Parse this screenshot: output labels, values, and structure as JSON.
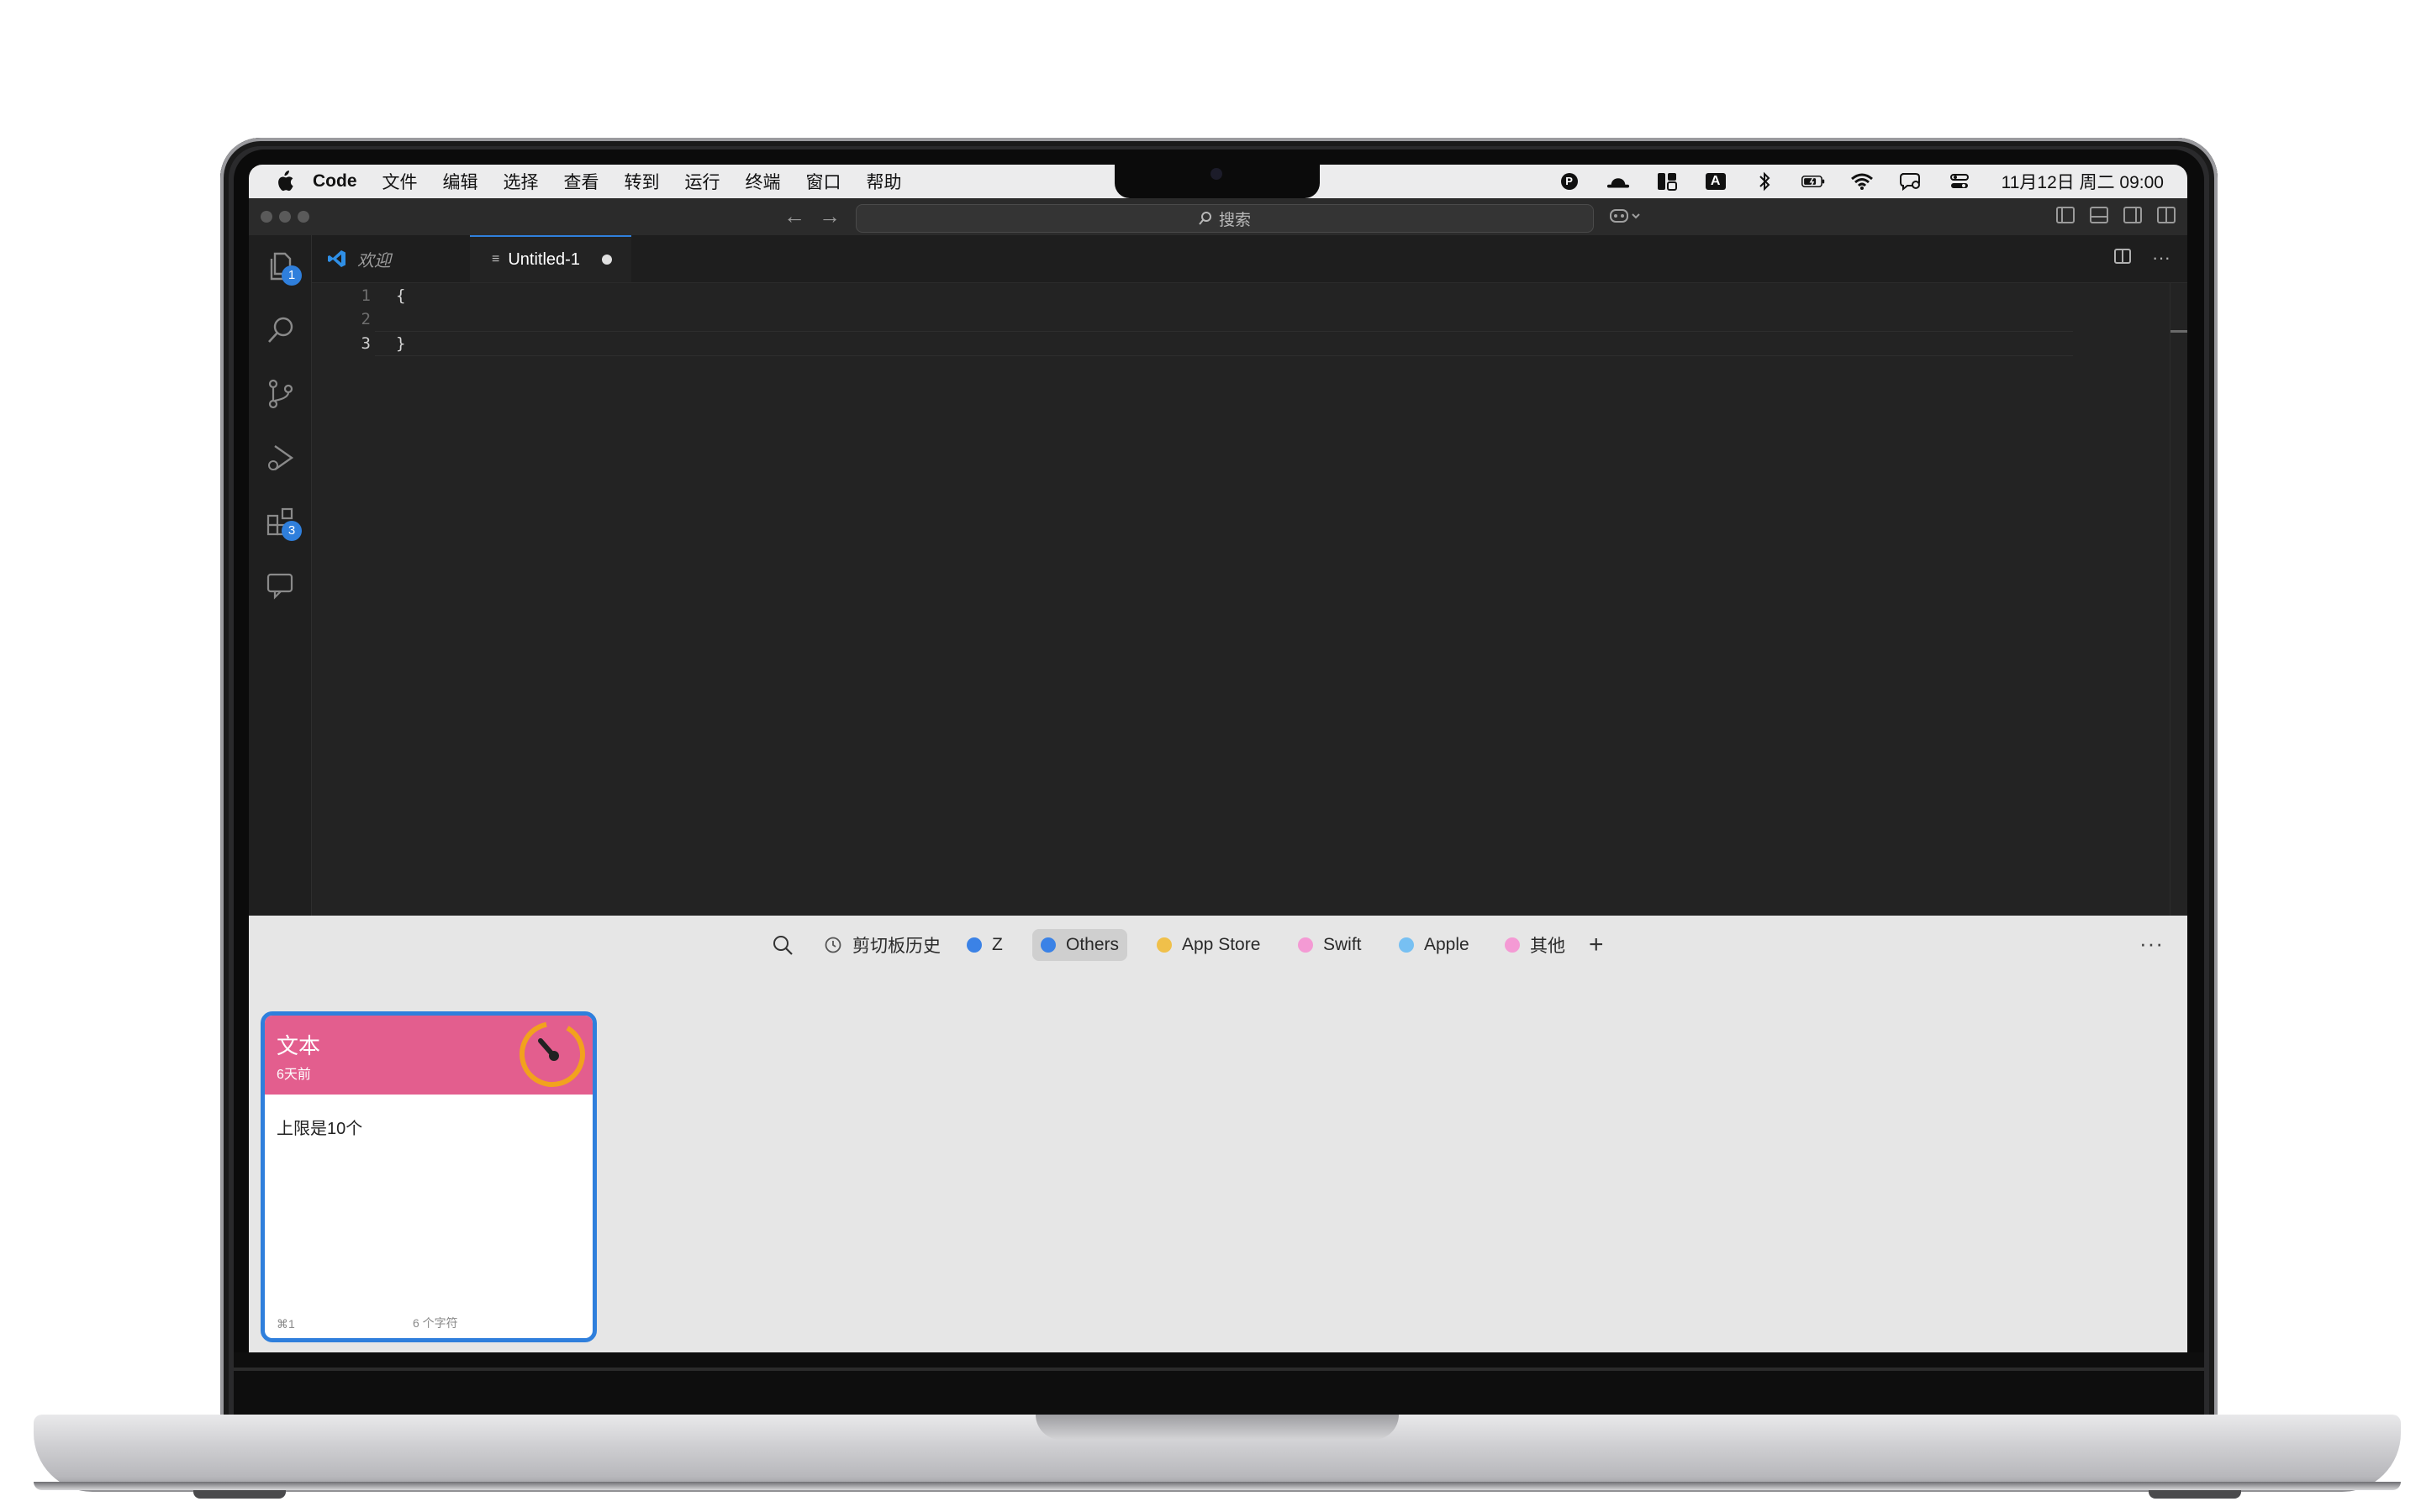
{
  "menubar": {
    "app_name": "Code",
    "items": [
      "文件",
      "编辑",
      "选择",
      "查看",
      "转到",
      "运行",
      "终端",
      "窗口",
      "帮助"
    ],
    "clock": "11月12日 周二  09:00",
    "input_method": "A",
    "extra_badge": "P"
  },
  "titlebar": {
    "search_placeholder": "搜索"
  },
  "activity": {
    "explorer_badge": "1",
    "extensions_badge": "3"
  },
  "tabs": [
    {
      "label": "欢迎",
      "active": false
    },
    {
      "label": "Untitled-1",
      "active": true,
      "dirty": true
    }
  ],
  "editor": {
    "lines": [
      {
        "num": "1",
        "text": "{"
      },
      {
        "num": "2",
        "text": ""
      },
      {
        "num": "3",
        "text": "}"
      }
    ],
    "current_line": 3
  },
  "clipboard": {
    "history_label": "剪切板历史",
    "pinboards": [
      {
        "label": "Z",
        "color": "#3b82e6"
      },
      {
        "label": "Others",
        "color": "#3b82e6",
        "selected": true
      },
      {
        "label": "App Store",
        "color": "#f0c04a"
      },
      {
        "label": "Swift",
        "color": "#f49ad4"
      },
      {
        "label": "Apple",
        "color": "#77c0f2"
      },
      {
        "label": "其他",
        "color": "#f49ad4"
      }
    ],
    "more": "···",
    "card": {
      "type": "文本",
      "time": "6天前",
      "content": "上限是10个",
      "shortcut": "⌘1",
      "chars": "6 个字符",
      "head_color": "#e35e8e",
      "timer_color": "#f2a21d"
    }
  }
}
